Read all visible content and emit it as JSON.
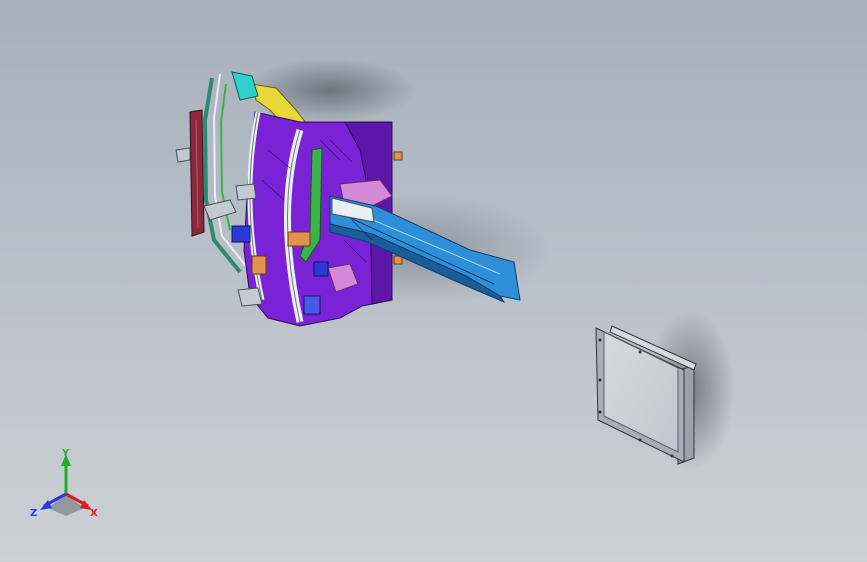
{
  "viewport": {
    "background_top": "#a7b1bb",
    "background_bottom": "#ccd1d6"
  },
  "model": {
    "colors": {
      "purple": "#7a22d6",
      "purple_dark": "#4e148f",
      "blue": "#2f8ed8",
      "blue_dark": "#1b5d99",
      "yellow": "#e8d83a",
      "green": "#3bb34a",
      "orange": "#e4934c",
      "maroon": "#8a2a3c",
      "pink": "#d48ad8",
      "white": "#e9eef2"
    }
  },
  "panel": {
    "face": "#cfd3da",
    "frame": "#9aa1ab"
  },
  "triad": {
    "x_label": "X",
    "y_label": "Y",
    "z_label": "Z",
    "x_color": "#d62020",
    "y_color": "#1fae2a",
    "z_color": "#2a3ad8"
  }
}
